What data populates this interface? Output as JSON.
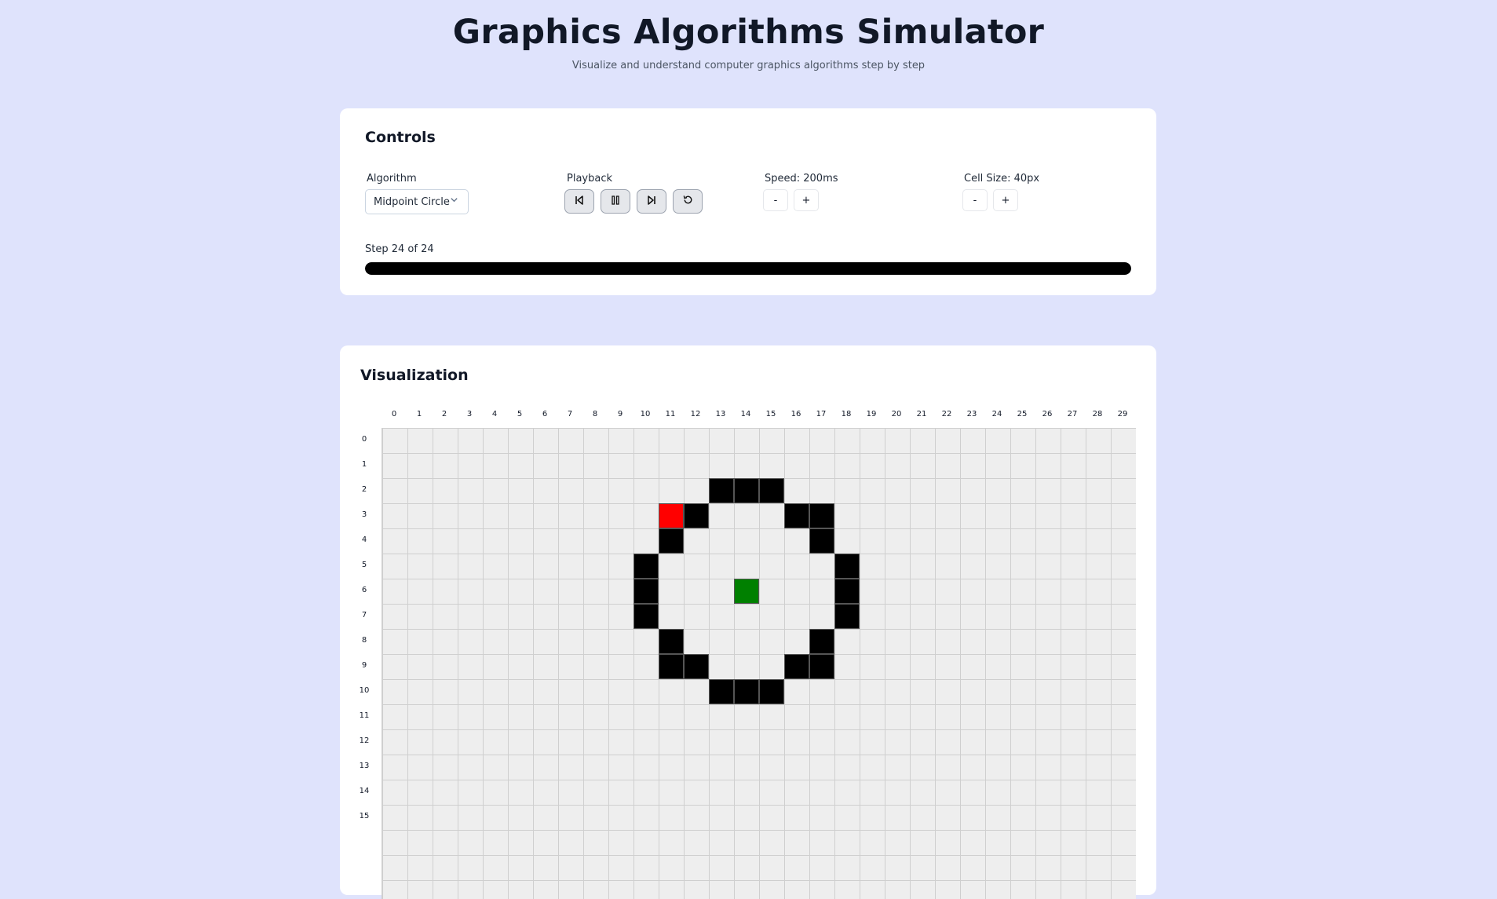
{
  "header": {
    "title": "Graphics Algorithms Simulator",
    "subtitle": "Visualize and understand computer graphics algorithms step by step"
  },
  "controls": {
    "title": "Controls",
    "algorithm_label": "Algorithm",
    "algorithm_value": "Midpoint Circle",
    "playback_label": "Playback",
    "speed_label": "Speed: 200ms",
    "cell_size_label": "Cell Size: 40px",
    "minus": "-",
    "plus": "+",
    "step_text": "Step 24 of 24",
    "progress": 1.0,
    "icons": {
      "first": "skip-to-start-icon",
      "pause": "pause-icon",
      "next": "step-forward-icon",
      "reset": "reset-icon"
    }
  },
  "visualization": {
    "title": "Visualization",
    "columns": [
      "0",
      "1",
      "2",
      "3",
      "4",
      "5",
      "6",
      "7",
      "8",
      "9",
      "10",
      "11",
      "12",
      "13",
      "14",
      "15",
      "16",
      "17",
      "18",
      "19",
      "20",
      "21",
      "22",
      "23",
      "24",
      "25",
      "26",
      "27",
      "28",
      "29"
    ],
    "rows": [
      "0",
      "1",
      "2",
      "3",
      "4",
      "5",
      "6",
      "7",
      "8",
      "9",
      "10",
      "11",
      "12",
      "13",
      "14",
      "15"
    ],
    "colors": {
      "plotted": "#000000",
      "current": "#ff0000",
      "center": "#008000",
      "cell": "#eeeeee",
      "grid_line": "#cfcfcf"
    },
    "center": [
      14,
      6
    ],
    "current": [
      11,
      3
    ],
    "plotted": [
      [
        13,
        2
      ],
      [
        14,
        2
      ],
      [
        15,
        2
      ],
      [
        12,
        3
      ],
      [
        16,
        3
      ],
      [
        17,
        3
      ],
      [
        11,
        4
      ],
      [
        17,
        4
      ],
      [
        10,
        5
      ],
      [
        18,
        5
      ],
      [
        10,
        6
      ],
      [
        18,
        6
      ],
      [
        10,
        7
      ],
      [
        18,
        7
      ],
      [
        11,
        8
      ],
      [
        17,
        8
      ],
      [
        11,
        9
      ],
      [
        12,
        9
      ],
      [
        16,
        9
      ],
      [
        17,
        9
      ],
      [
        13,
        10
      ],
      [
        14,
        10
      ],
      [
        15,
        10
      ]
    ]
  }
}
